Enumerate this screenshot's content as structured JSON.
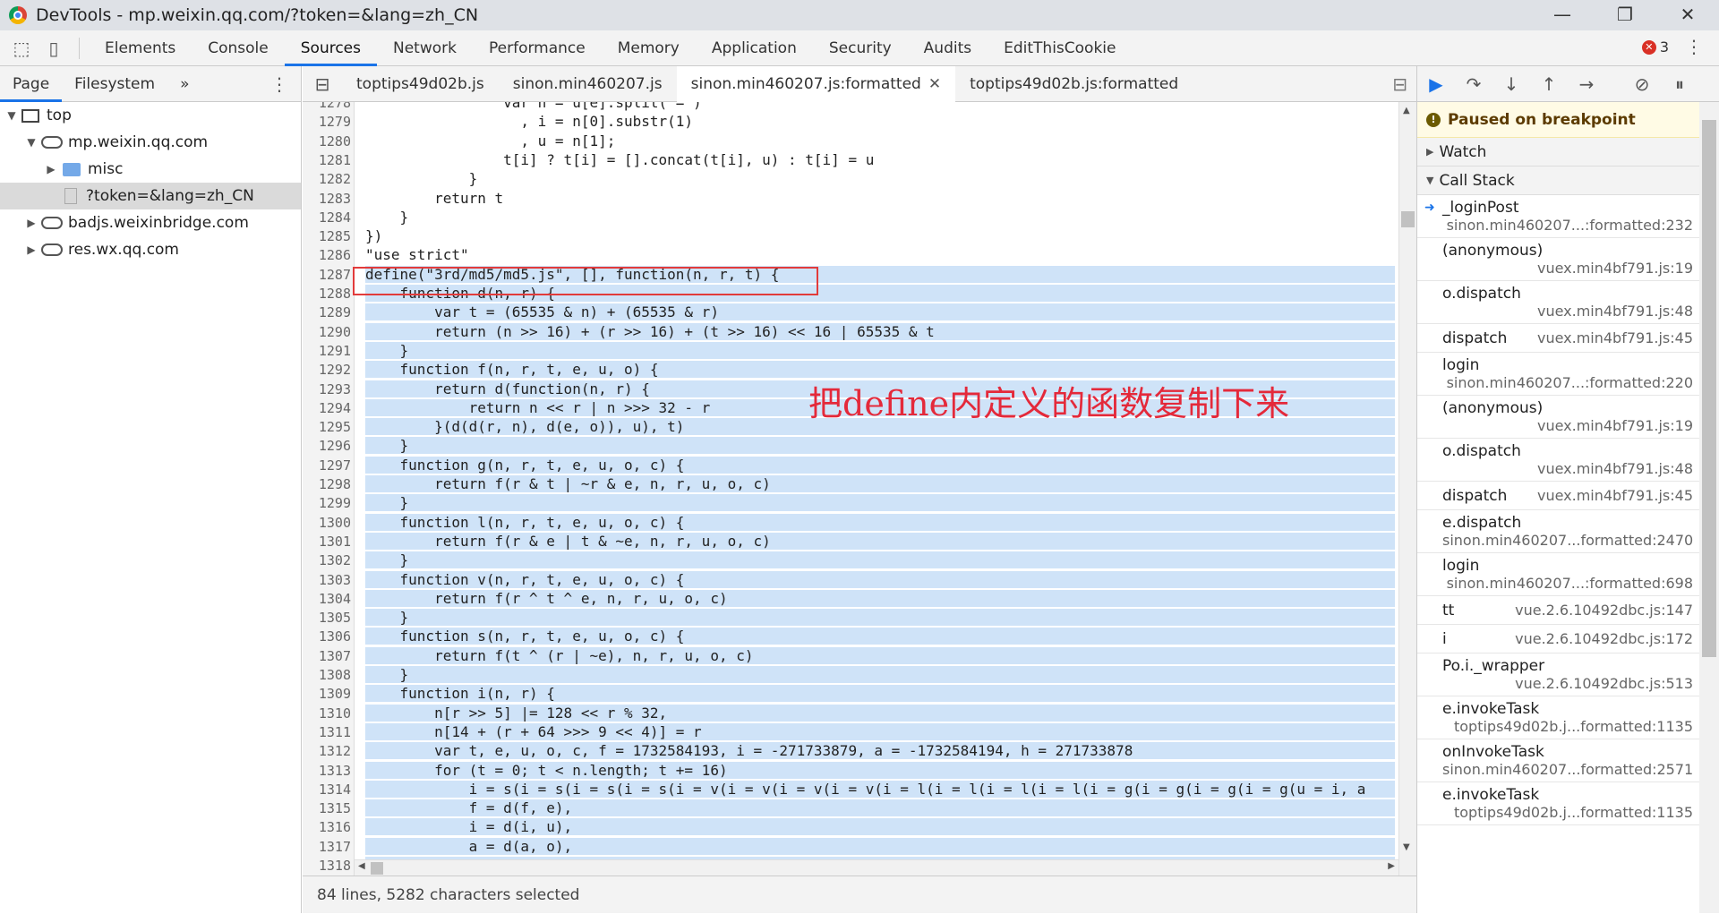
{
  "window": {
    "title": "DevTools - mp.weixin.qq.com/?token=&lang=zh_CN",
    "controls": [
      "—",
      "❐",
      "✕"
    ]
  },
  "toolbar": {
    "tabs": [
      "Elements",
      "Console",
      "Sources",
      "Network",
      "Performance",
      "Memory",
      "Application",
      "Security",
      "Audits",
      "EditThisCookie"
    ],
    "active_tab": "Sources",
    "error_count": "3"
  },
  "navigator": {
    "tabs": [
      "Page",
      "Filesystem",
      "»"
    ],
    "tree": [
      {
        "label": "top",
        "depth": 0,
        "type": "frame",
        "arrow": "▼"
      },
      {
        "label": "mp.weixin.qq.com",
        "depth": 1,
        "type": "cloud",
        "arrow": "▼"
      },
      {
        "label": "misc",
        "depth": 2,
        "type": "folder",
        "arrow": "▶"
      },
      {
        "label": "?token=&lang=zh_CN",
        "depth": 2,
        "type": "file",
        "arrow": ""
      },
      {
        "label": "badjs.weixinbridge.com",
        "depth": 1,
        "type": "cloud",
        "arrow": "▶"
      },
      {
        "label": "res.wx.qq.com",
        "depth": 1,
        "type": "cloud",
        "arrow": "▶"
      }
    ]
  },
  "editor": {
    "file_tabs": [
      "toptips49d02b.js",
      "sinon.min460207.js",
      "sinon.min460207.js:formatted",
      "toptips49d02b.js:formatted"
    ],
    "active_file_tab": "sinon.min460207.js:formatted",
    "lines": [
      {
        "n": "1278",
        "code": "                var n = u[e].split(\"=\")"
      },
      {
        "n": "1279",
        "code": "                  , i = n[0].substr(1)"
      },
      {
        "n": "1280",
        "code": "                  , u = n[1];"
      },
      {
        "n": "1281",
        "code": "                t[i] ? t[i] = [].concat(t[i], u) : t[i] = u"
      },
      {
        "n": "1282",
        "code": "            }"
      },
      {
        "n": "1283",
        "code": "        return t"
      },
      {
        "n": "1284",
        "code": "    }"
      },
      {
        "n": "1285",
        "code": "})"
      },
      {
        "n": "1286",
        "code": "\"use strict\""
      },
      {
        "n": "1287",
        "code": "define(\"3rd/md5/md5.js\", [], function(n, r, t) {"
      },
      {
        "n": "1288",
        "code": "    function d(n, r) {"
      },
      {
        "n": "1289",
        "code": "        var t = (65535 & n) + (65535 & r)"
      },
      {
        "n": "1290",
        "code": "        return (n >> 16) + (r >> 16) + (t >> 16) << 16 | 65535 & t"
      },
      {
        "n": "1291",
        "code": "    }"
      },
      {
        "n": "1292",
        "code": "    function f(n, r, t, e, u, o) {"
      },
      {
        "n": "1293",
        "code": "        return d(function(n, r) {"
      },
      {
        "n": "1294",
        "code": "            return n << r | n >>> 32 - r"
      },
      {
        "n": "1295",
        "code": "        }(d(d(r, n), d(e, o)), u), t)"
      },
      {
        "n": "1296",
        "code": "    }"
      },
      {
        "n": "1297",
        "code": "    function g(n, r, t, e, u, o, c) {"
      },
      {
        "n": "1298",
        "code": "        return f(r & t | ~r & e, n, r, u, o, c)"
      },
      {
        "n": "1299",
        "code": "    }"
      },
      {
        "n": "1300",
        "code": "    function l(n, r, t, e, u, o, c) {"
      },
      {
        "n": "1301",
        "code": "        return f(r & e | t & ~e, n, r, u, o, c)"
      },
      {
        "n": "1302",
        "code": "    }"
      },
      {
        "n": "1303",
        "code": "    function v(n, r, t, e, u, o, c) {"
      },
      {
        "n": "1304",
        "code": "        return f(r ^ t ^ e, n, r, u, o, c)"
      },
      {
        "n": "1305",
        "code": "    }"
      },
      {
        "n": "1306",
        "code": "    function s(n, r, t, e, u, o, c) {"
      },
      {
        "n": "1307",
        "code": "        return f(t ^ (r | ~e), n, r, u, o, c)"
      },
      {
        "n": "1308",
        "code": "    }"
      },
      {
        "n": "1309",
        "code": "    function i(n, r) {"
      },
      {
        "n": "1310",
        "code": "        n[r >> 5] |= 128 << r % 32,"
      },
      {
        "n": "1311",
        "code": "        n[14 + (r + 64 >>> 9 << 4)] = r"
      },
      {
        "n": "1312",
        "code": "        var t, e, u, o, c, f = 1732584193, i = -271733879, a = -1732584194, h = 271733878"
      },
      {
        "n": "1313",
        "code": "        for (t = 0; t < n.length; t += 16)"
      },
      {
        "n": "1314",
        "code": "            i = s(i = s(i = s(i = s(i = v(i = v(i = v(i = v(i = l(i = l(i = l(i = l(i = g(i = g(i = g(i = g(u = i, a"
      },
      {
        "n": "1315",
        "code": "            f = d(f, e),"
      },
      {
        "n": "1316",
        "code": "            i = d(i, u),"
      },
      {
        "n": "1317",
        "code": "            a = d(a, o),"
      },
      {
        "n": "1318",
        "code": "            h = d(h, c)"
      },
      {
        "n": "1319",
        "code": ""
      }
    ],
    "selection_start": "1287",
    "annotation": "把define内定义的函数复制下来",
    "status": "84 lines, 5282 characters selected"
  },
  "debugger": {
    "paused_text": "Paused on breakpoint",
    "watch_label": "Watch",
    "callstack_label": "Call Stack",
    "frames": [
      {
        "fn": "_loginPost",
        "loc": "sinon.min460207...:formatted:232",
        "current": true
      },
      {
        "fn": "(anonymous)",
        "loc": "vuex.min4bf791.js:19"
      },
      {
        "fn": "o.dispatch",
        "loc": "vuex.min4bf791.js:48"
      },
      {
        "fn": "dispatch",
        "loc": "vuex.min4bf791.js:45",
        "inline": true
      },
      {
        "fn": "login",
        "loc": "sinon.min460207...:formatted:220"
      },
      {
        "fn": "(anonymous)",
        "loc": "vuex.min4bf791.js:19"
      },
      {
        "fn": "o.dispatch",
        "loc": "vuex.min4bf791.js:48"
      },
      {
        "fn": "dispatch",
        "loc": "vuex.min4bf791.js:45",
        "inline": true
      },
      {
        "fn": "e.dispatch",
        "loc": "sinon.min460207...formatted:2470"
      },
      {
        "fn": "login",
        "loc": "sinon.min460207...:formatted:698"
      },
      {
        "fn": "tt",
        "loc": "vue.2.6.10492dbc.js:147",
        "inline": true
      },
      {
        "fn": "i",
        "loc": "vue.2.6.10492dbc.js:172",
        "inline": true
      },
      {
        "fn": "Po.i._wrapper",
        "loc": "vue.2.6.10492dbc.js:513"
      },
      {
        "fn": "e.invokeTask",
        "loc": "toptips49d02b.j...formatted:1135"
      },
      {
        "fn": "onInvokeTask",
        "loc": "sinon.min460207...formatted:2571"
      },
      {
        "fn": "e.invokeTask",
        "loc": "toptips49d02b.j...formatted:1135"
      }
    ]
  },
  "colors": {
    "accent": "#1a73e8",
    "selection": "#cfe3f8",
    "annotation": "#e4293a",
    "error": "#d93025"
  }
}
